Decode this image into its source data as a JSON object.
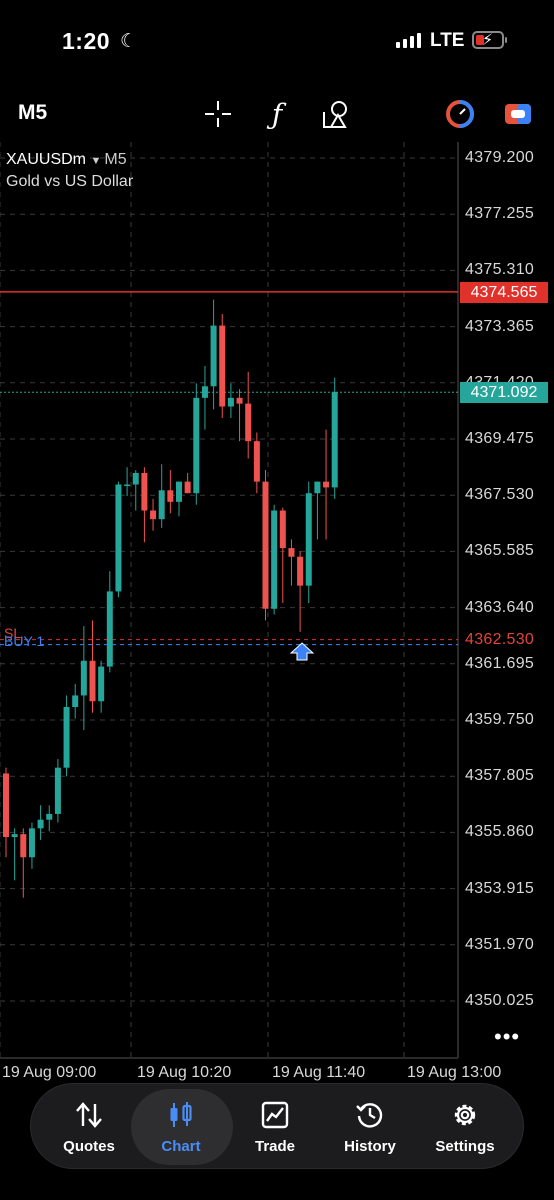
{
  "status": {
    "time": "1:20",
    "network": "LTE"
  },
  "toolbar": {
    "timeframe": "M5"
  },
  "chart_header": {
    "symbol": "XAUUSDm",
    "timeframe": "M5",
    "description": "Gold vs US Dollar"
  },
  "chart_data": {
    "type": "candlestick",
    "y_ticks": [
      "4379.200",
      "4377.255",
      "4375.310",
      "4373.365",
      "4371.420",
      "4369.475",
      "4367.530",
      "4365.585",
      "4363.640",
      "4361.695",
      "4359.750",
      "4357.805",
      "4355.860",
      "4353.915",
      "4351.970",
      "4350.025"
    ],
    "x_ticks": [
      "19 Aug 09:00",
      "19 Aug 10:20",
      "19 Aug 11:40",
      "19 Aug 13:00"
    ],
    "current_price": "4371.092",
    "sl_price": "4362.530",
    "red_line_price": "4374.565",
    "sl_label": "SL",
    "order_label": "BUY 1",
    "colors": {
      "bull": "#26a69a",
      "bear": "#ef5350",
      "grid": "#3a3a3a"
    },
    "candles": [
      {
        "o": 4357.9,
        "h": 4358.1,
        "l": 4355.0,
        "c": 4355.7
      },
      {
        "o": 4355.7,
        "h": 4356.0,
        "l": 4354.2,
        "c": 4355.8
      },
      {
        "o": 4355.8,
        "h": 4356.0,
        "l": 4353.6,
        "c": 4355.0
      },
      {
        "o": 4355.0,
        "h": 4356.2,
        "l": 4354.6,
        "c": 4356.0
      },
      {
        "o": 4356.0,
        "h": 4356.8,
        "l": 4355.6,
        "c": 4356.3
      },
      {
        "o": 4356.3,
        "h": 4356.8,
        "l": 4355.9,
        "c": 4356.5
      },
      {
        "o": 4356.5,
        "h": 4358.4,
        "l": 4356.2,
        "c": 4358.1
      },
      {
        "o": 4358.1,
        "h": 4360.6,
        "l": 4357.8,
        "c": 4360.2
      },
      {
        "o": 4360.2,
        "h": 4361.0,
        "l": 4359.8,
        "c": 4360.6
      },
      {
        "o": 4360.6,
        "h": 4363.0,
        "l": 4359.4,
        "c": 4361.8
      },
      {
        "o": 4361.8,
        "h": 4363.2,
        "l": 4360.0,
        "c": 4360.4
      },
      {
        "o": 4360.4,
        "h": 4361.8,
        "l": 4360.0,
        "c": 4361.6
      },
      {
        "o": 4361.6,
        "h": 4364.9,
        "l": 4361.4,
        "c": 4364.2
      },
      {
        "o": 4364.2,
        "h": 4368.0,
        "l": 4364.0,
        "c": 4367.9
      },
      {
        "o": 4367.9,
        "h": 4368.5,
        "l": 4367.5,
        "c": 4367.9
      },
      {
        "o": 4367.9,
        "h": 4368.4,
        "l": 4367.0,
        "c": 4368.3
      },
      {
        "o": 4368.3,
        "h": 4368.5,
        "l": 4365.9,
        "c": 4367.0
      },
      {
        "o": 4367.0,
        "h": 4367.4,
        "l": 4366.3,
        "c": 4366.7
      },
      {
        "o": 4366.7,
        "h": 4368.6,
        "l": 4366.4,
        "c": 4367.7
      },
      {
        "o": 4367.7,
        "h": 4368.4,
        "l": 4366.9,
        "c": 4367.3
      },
      {
        "o": 4367.3,
        "h": 4368.0,
        "l": 4366.8,
        "c": 4368.0
      },
      {
        "o": 4368.0,
        "h": 4368.3,
        "l": 4367.6,
        "c": 4367.6
      },
      {
        "o": 4367.6,
        "h": 4371.4,
        "l": 4367.2,
        "c": 4370.9
      },
      {
        "o": 4370.9,
        "h": 4372.0,
        "l": 4369.8,
        "c": 4371.3
      },
      {
        "o": 4371.3,
        "h": 4374.3,
        "l": 4370.5,
        "c": 4373.4
      },
      {
        "o": 4373.4,
        "h": 4373.8,
        "l": 4370.2,
        "c": 4370.6
      },
      {
        "o": 4370.6,
        "h": 4371.4,
        "l": 4370.2,
        "c": 4370.9
      },
      {
        "o": 4370.9,
        "h": 4371.2,
        "l": 4369.4,
        "c": 4370.7
      },
      {
        "o": 4370.7,
        "h": 4371.8,
        "l": 4368.8,
        "c": 4369.4
      },
      {
        "o": 4369.4,
        "h": 4369.7,
        "l": 4367.6,
        "c": 4368.0
      },
      {
        "o": 4368.0,
        "h": 4368.4,
        "l": 4363.2,
        "c": 4363.6
      },
      {
        "o": 4363.6,
        "h": 4367.2,
        "l": 4363.4,
        "c": 4367.0
      },
      {
        "o": 4367.0,
        "h": 4367.1,
        "l": 4363.8,
        "c": 4365.7
      },
      {
        "o": 4365.7,
        "h": 4366.0,
        "l": 4364.4,
        "c": 4365.4
      },
      {
        "o": 4365.4,
        "h": 4365.6,
        "l": 4362.8,
        "c": 4364.4
      },
      {
        "o": 4364.4,
        "h": 4368.0,
        "l": 4363.8,
        "c": 4367.6
      },
      {
        "o": 4367.6,
        "h": 4368.0,
        "l": 4366.0,
        "c": 4368.0
      },
      {
        "o": 4368.0,
        "h": 4369.8,
        "l": 4366.0,
        "c": 4367.8
      },
      {
        "o": 4367.8,
        "h": 4371.6,
        "l": 4367.4,
        "c": 4371.1
      }
    ]
  },
  "nav": {
    "items": [
      {
        "label": "Quotes"
      },
      {
        "label": "Chart"
      },
      {
        "label": "Trade"
      },
      {
        "label": "History"
      },
      {
        "label": "Settings"
      }
    ]
  }
}
